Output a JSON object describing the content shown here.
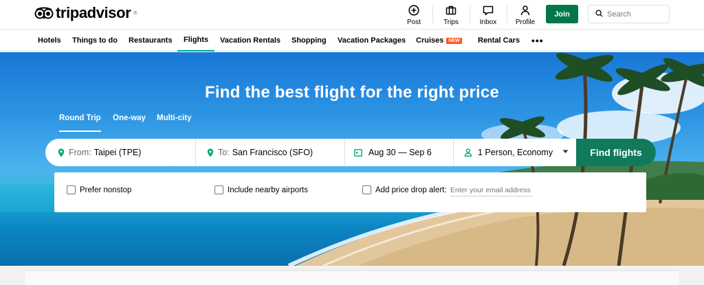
{
  "brand": {
    "name": "tripadvisor",
    "reg": "®",
    "color": "#00aa6c"
  },
  "header": {
    "nav": [
      {
        "label": "Post",
        "icon": "plus-circle-icon"
      },
      {
        "label": "Trips",
        "icon": "briefcase-icon"
      },
      {
        "label": "Inbox",
        "icon": "message-icon"
      },
      {
        "label": "Profile",
        "icon": "user-icon"
      }
    ],
    "join_label": "Join",
    "search_placeholder": "Search"
  },
  "categories": [
    {
      "label": "Hotels"
    },
    {
      "label": "Things to do"
    },
    {
      "label": "Restaurants"
    },
    {
      "label": "Flights",
      "active": true
    },
    {
      "label": "Vacation Rentals"
    },
    {
      "label": "Shopping"
    },
    {
      "label": "Vacation Packages"
    },
    {
      "label": "Cruises",
      "badge": "NEW"
    },
    {
      "label": "Rental Cars"
    },
    {
      "label": "•••"
    }
  ],
  "hero": {
    "title": "Find the best flight for the right price",
    "trip_types": [
      {
        "label": "Round Trip",
        "active": true
      },
      {
        "label": "One-way"
      },
      {
        "label": "Multi-city"
      }
    ]
  },
  "search": {
    "from_label": "From:",
    "from_value": "Taipei (TPE)",
    "to_label": "To:",
    "to_value": "San Francisco (SFO)",
    "dates": "Aug 30 — Sep 6",
    "travelers": "1 Person, Economy",
    "find_label": "Find flights"
  },
  "options": {
    "nonstop": "Prefer nonstop",
    "nearby": "Include nearby airports",
    "price_alert": "Add price drop alert:",
    "email_placeholder": "Enter your email address"
  },
  "colors": {
    "accent": "#00aa6c",
    "find_button": "#117a5a",
    "join_button": "#00774a",
    "new_badge": "#ff5722"
  }
}
